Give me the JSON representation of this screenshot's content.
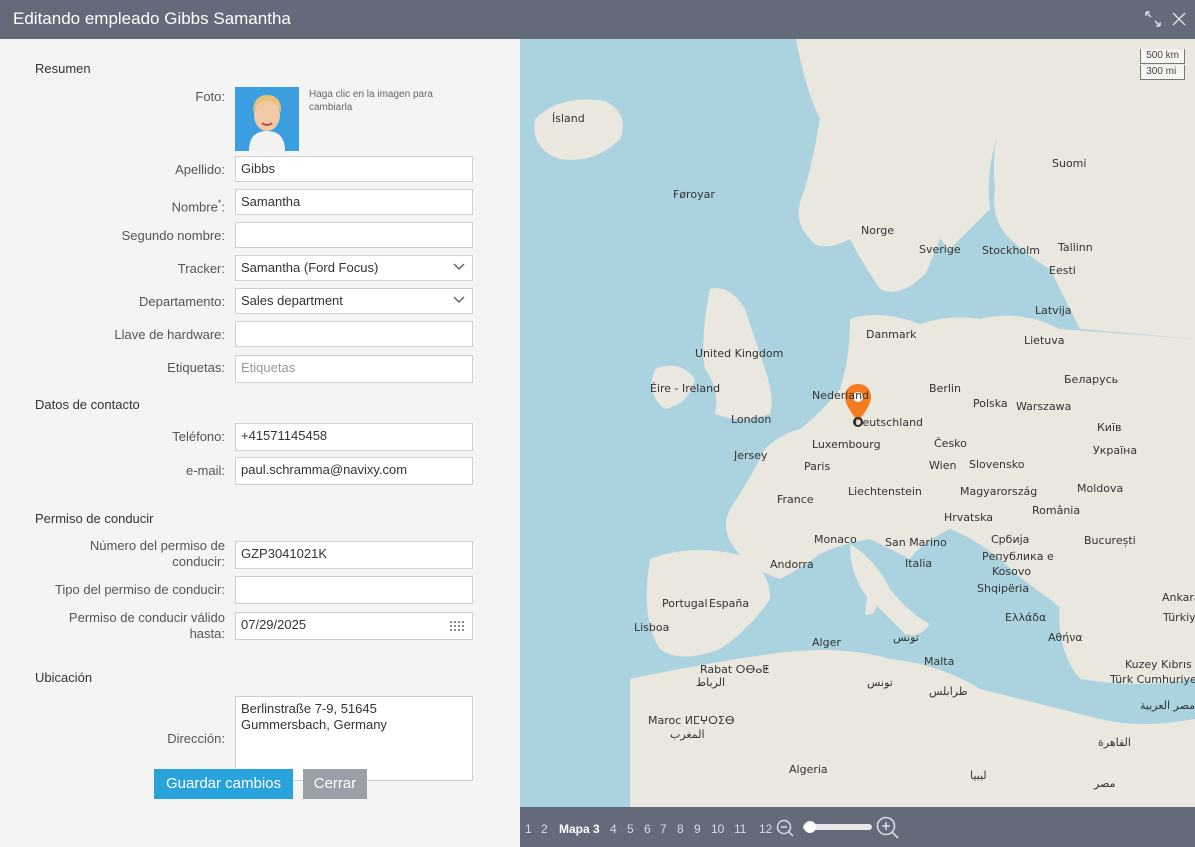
{
  "window": {
    "title": "Editando empleado Gibbs Samantha"
  },
  "form": {
    "section_summary": "Resumen",
    "photo_label": "Foto:",
    "photo_hint": "Haga clic en la imagen para cambiarla",
    "last_name_label": "Apellido:",
    "last_name_value": "Gibbs",
    "first_name_label": "Nombre",
    "first_name_required": "*",
    "first_name_colon": ":",
    "first_name_value": "Samantha",
    "middle_name_label": "Segundo nombre:",
    "middle_name_value": "",
    "tracker_label": "Tracker:",
    "tracker_value": "Samantha (Ford Focus)",
    "department_label": "Departamento:",
    "department_value": "Sales department",
    "hardware_key_label": "Llave de hardware:",
    "hardware_key_value": "",
    "tags_label": "Etiquetas:",
    "tags_placeholder": "Etiquetas",
    "section_contact": "Datos de contacto",
    "phone_label": "Teléfono:",
    "phone_value": "+41571145458",
    "email_label": "e-mail:",
    "email_value": "paul.schramma@navixy.com",
    "section_license": "Permiso de conducir",
    "license_number_label_1": "Número del permiso de",
    "license_number_label_2": "conducir:",
    "license_number_value": "GZP3041021K",
    "license_type_label": "Tipo del permiso de conducir:",
    "license_type_value": "",
    "license_valid_label_1": "Permiso de conducir válido",
    "license_valid_label_2": "hasta:",
    "license_valid_value": "07/29/2025",
    "section_location": "Ubicación",
    "address_label": "Dirección:",
    "address_line_1": "Berlinstraße 7-9, 51645",
    "address_line_2": "Gummersbach, Germany"
  },
  "buttons": {
    "save": "Guardar cambios",
    "close": "Cerrar"
  },
  "map": {
    "scale_km": "500 km",
    "scale_mi": "300 mi",
    "labels": {
      "island": "Ísland",
      "faroe": "Føroyar",
      "suomi": "Suomi",
      "norge": "Norge",
      "sverige": "Sverige",
      "stockholm": "Stockholm",
      "tallinn": "Tallinn",
      "eesti": "Eesti",
      "latvija": "Latvija",
      "danmark": "Danmark",
      "lietuva": "Lietuva",
      "uk": "United Kingdom",
      "eire": "Éire - Ireland",
      "berlin": "Berlin",
      "belarus": "Беларусь",
      "nederland": "Nederland",
      "polska": "Polska",
      "warszawa": "Warszawa",
      "london": "London",
      "deutschland": "Deutschland",
      "luxembourg": "Luxembourg",
      "cesko": "Česko",
      "kyiv": "Київ",
      "ukraina": "Україна",
      "jersey": "Jersey",
      "paris": "Paris",
      "wien": "Wien",
      "slovensko": "Slovensko",
      "france": "France",
      "liechtenstein": "Liechtenstein",
      "magyarorszag": "Magyarország",
      "moldova": "Moldova",
      "hrvatska": "Hrvatska",
      "romania": "România",
      "monaco": "Monaco",
      "sanmarino": "San Marino",
      "srbija": "Србија",
      "bucuresti": "București",
      "andorra": "Andorra",
      "italia": "Italia",
      "makedonija": "Република е",
      "kosovo": "Kosovo",
      "shqiperia": "Shqipëria",
      "portugal": "Portugal",
      "espana": "España",
      "ankara": "Ankara",
      "turkiye": "Türkiye",
      "lisboa": "Lisboa",
      "ellada": "Ελλάδα",
      "athina": "Αθήνα",
      "alger": "Alger",
      "tunis": "تونس",
      "malta": "Malta",
      "kuzey": "Kuzey Kıbrıs",
      "turk_cum": "Türk Cumhuriye",
      "rabat": "Rabat ⵔⴱⴰⵟ",
      "rabat_ar": "الرباط",
      "tunisia": "تونس",
      "tripoli": "طرابلس",
      "misr_ar": "مصر العربية",
      "maroc": "Maroc ⵍⵎⵖⵔⵉⴱ",
      "maghrib_ar": "المغرب",
      "cairo": "القاهرة",
      "algeria": "Algeria",
      "libya": "ليبيا",
      "misr": "مصر"
    }
  },
  "map_pages": {
    "p1": "1",
    "p2": "2",
    "current": "Mapa 3",
    "p4": "4",
    "p5": "5",
    "p6": "6",
    "p7": "7",
    "p8": "8",
    "p9": "9",
    "p10": "10",
    "p11": "11",
    "p12": "12"
  }
}
